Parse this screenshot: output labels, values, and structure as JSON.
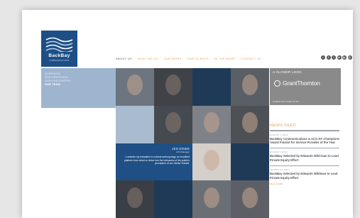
{
  "logo": {
    "name": "BackBay",
    "sub": "COMMUNICATIONS"
  },
  "nav": [
    {
      "label": "ABOUT US",
      "active": true
    },
    {
      "label": "WHAT WE DO",
      "active": false
    },
    {
      "label": "OUR WORK",
      "active": false
    },
    {
      "label": "OUR CLIENTS",
      "active": false
    },
    {
      "label": "IN THE NEWS",
      "active": false
    },
    {
      "label": "CONTACT US",
      "active": false
    }
  ],
  "social": [
    "rss-icon",
    "facebook-icon",
    "twitter-icon",
    "linkedin-icon",
    "youtube-icon",
    "email-icon"
  ],
  "subnav": {
    "items": [
      "OVERVIEW",
      "OUR APPROACH",
      "OUR PHILOSOPHY",
      "OUR TEAM"
    ],
    "current": 3
  },
  "bio": {
    "name": "JEN DOWD",
    "title": "ACS Manager",
    "quote": "I consider my education in cultural anthropology an excellent platform from which to delve into the intricacies of the public's perception of our clients' brands."
  },
  "sidebar": {
    "closer_label": "A CLOSER LOOK",
    "client_brand": "GrantThornton",
    "download_label": "DOWNLOAD CASE STUDY"
  },
  "news": {
    "title": "NEWS FEED",
    "items": [
      {
        "date": "AUGUST 1 2014",
        "headline": "BackBay Communications & ACG NY Champions Award Finalist for Service Provider of the Year"
      },
      {
        "date": "AUGUST 1 2014",
        "headline": "BackBay Selected by Edwards Wild-man to Lead Private Equity Effort"
      },
      {
        "date": "AUGUST 11 2014",
        "headline": "BackBay Selected by Edwards Wildman to Lead Private Equity Effort"
      }
    ],
    "more_label": "READ MORE"
  },
  "colors": {
    "brand_blue": "#1d4f86",
    "accent_orange": "#e9a25a",
    "tile_light": "#9eb5cf"
  }
}
